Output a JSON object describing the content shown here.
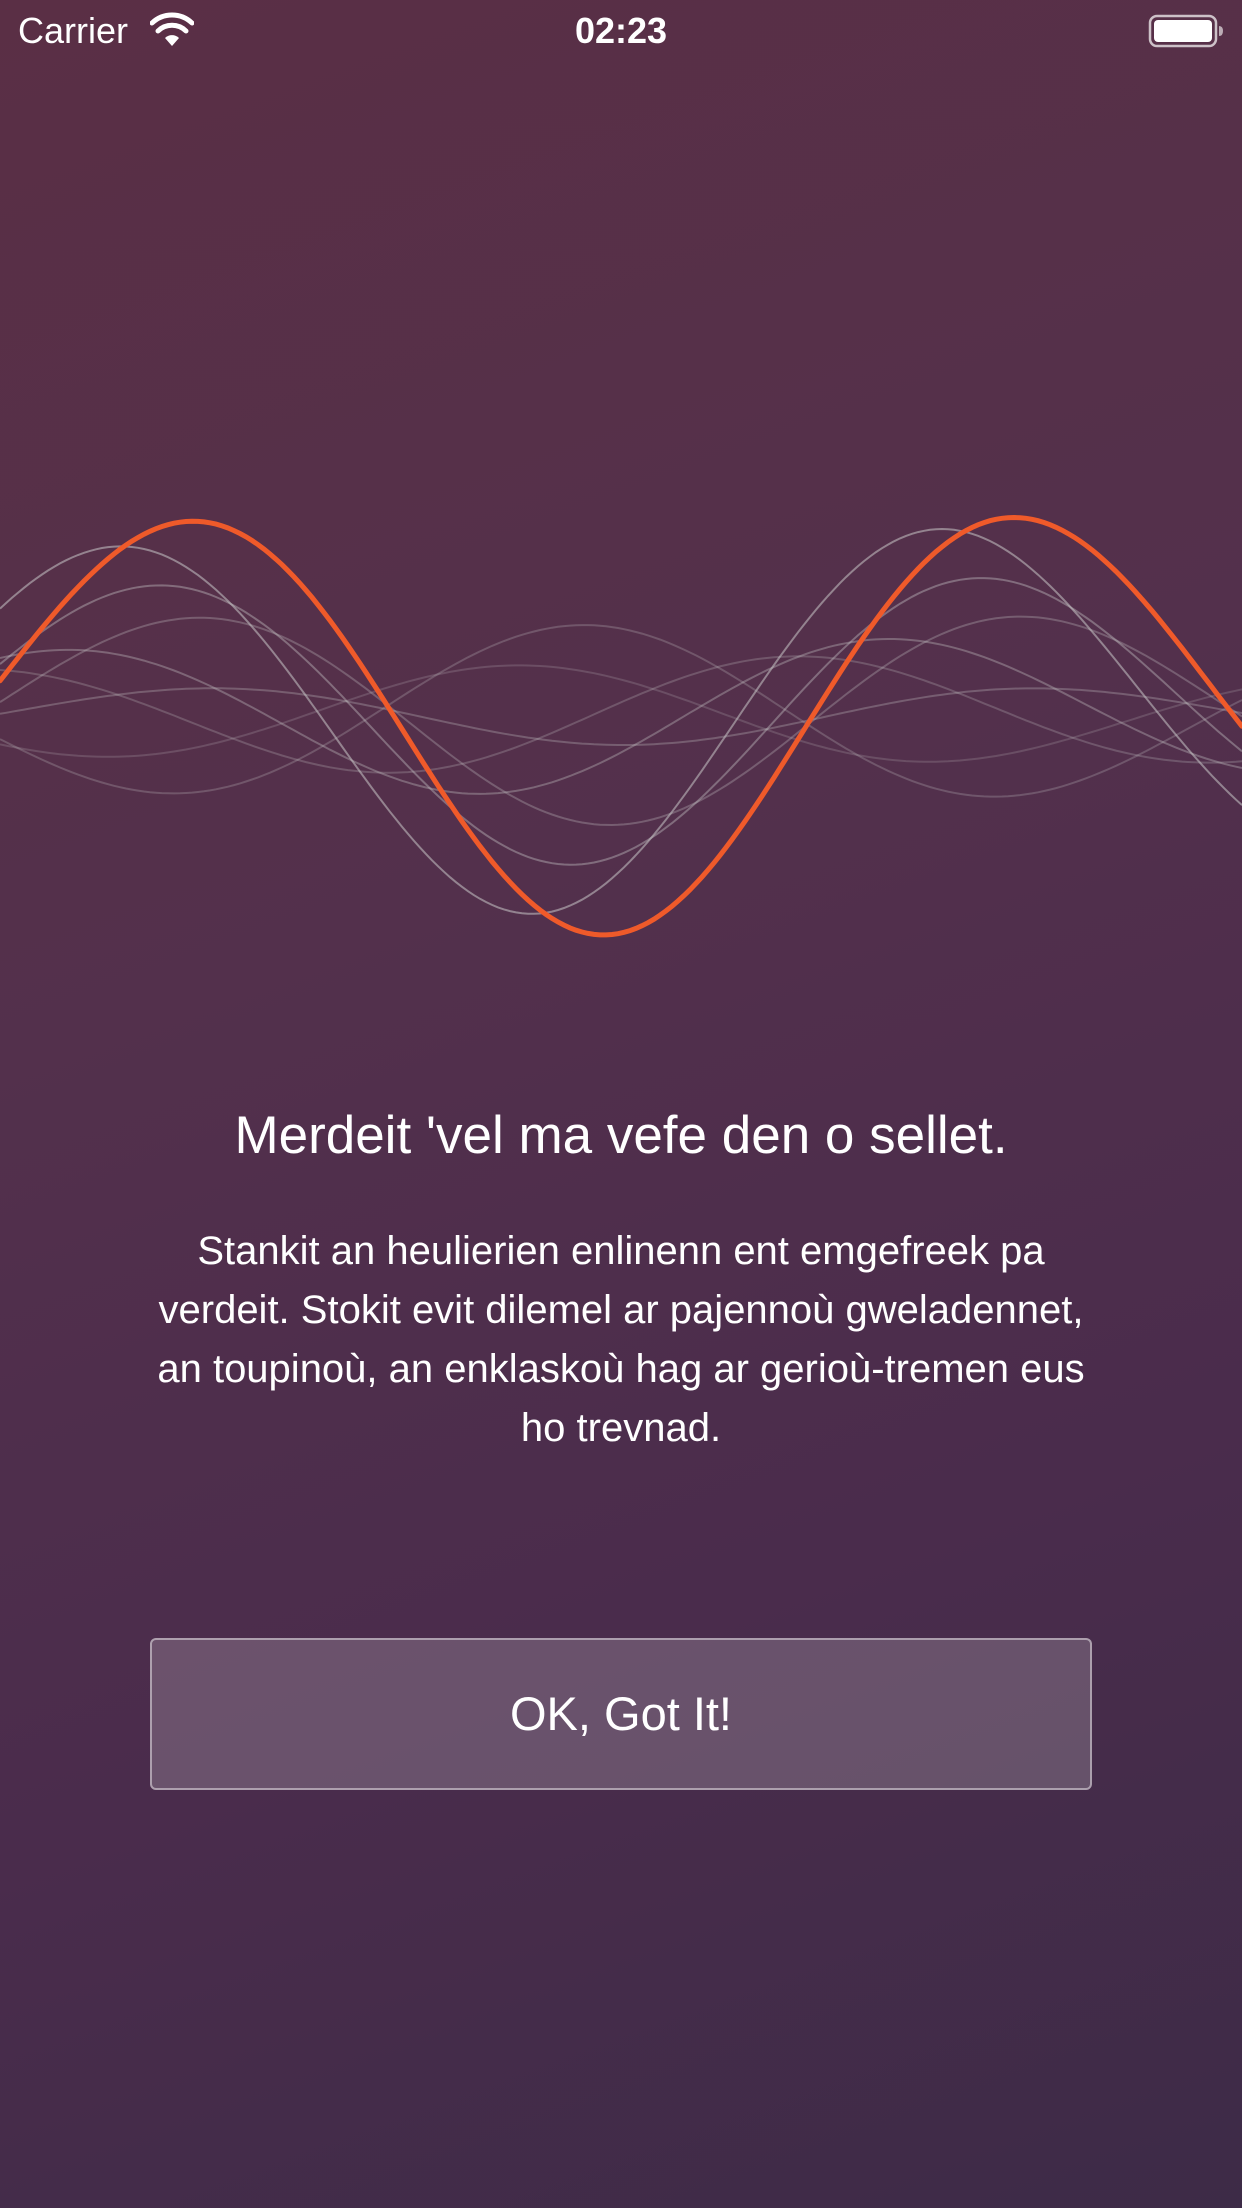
{
  "status_bar": {
    "carrier": "Carrier",
    "time": "02:23",
    "wifi_icon": "wifi-icon",
    "battery_icon": "battery-icon"
  },
  "waveform": {
    "icon": "audio-waveform-graphic",
    "accent_color": "#ef5a2a",
    "faint_color": "#c8c8c8"
  },
  "onboarding": {
    "title": "Merdeit 'vel ma vefe den o sellet.",
    "body": "Stankit an heulierien enlinenn ent emgefreek pa verdeit. Stokit evit dilemel ar pajennoù gweladennet, an toupinoù, an enklaskoù hag ar gerioù-tremen eus ho trevnad.",
    "ok_label": "OK, Got It!"
  },
  "colors": {
    "background_start": "#5a2f45",
    "background_end": "#3d2b47",
    "text": "#ffffff"
  }
}
